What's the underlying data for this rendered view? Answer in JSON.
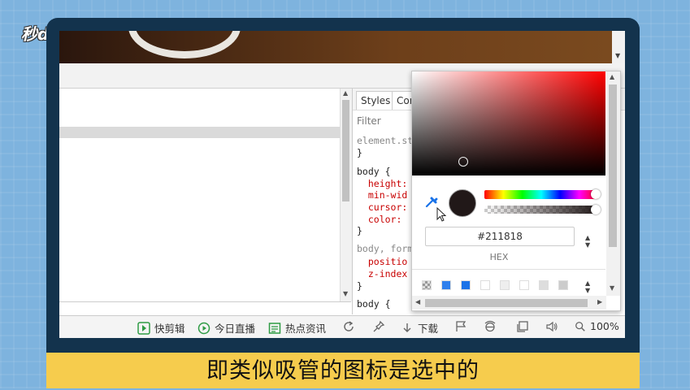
{
  "logo": {
    "text": "秒dong视频"
  },
  "devtools": {
    "tabs": [
      "Styles",
      "Cor"
    ],
    "filter_placeholder": "Filter",
    "code_lines": [
      "element.st",
      "}",
      "body {",
      "  height:",
      "  min-wid",
      "  cursor:",
      "  color:",
      "}",
      "body, form",
      "  positio",
      "  z-index",
      "}",
      "body {"
    ]
  },
  "color_picker": {
    "current_color": "#211818",
    "hex_value": "#211818",
    "format_label": "HEX",
    "palette": [
      "#9a9a9a",
      "#2f80ed",
      "#1a73e8",
      "#ffffff",
      "#eeeeee",
      "#ffffff",
      "#dddddd",
      "#cccccc"
    ]
  },
  "bottom_bar": {
    "items": [
      {
        "label": "快剪辑",
        "icon": "video-edit-icon"
      },
      {
        "label": "今日直播",
        "icon": "play-circle-icon"
      },
      {
        "label": "热点资讯",
        "icon": "news-icon"
      },
      {
        "label": "下载",
        "icon": "download-icon"
      }
    ],
    "zoom": "100%"
  },
  "caption": {
    "text": "即类似吸管的图标是选中的"
  }
}
